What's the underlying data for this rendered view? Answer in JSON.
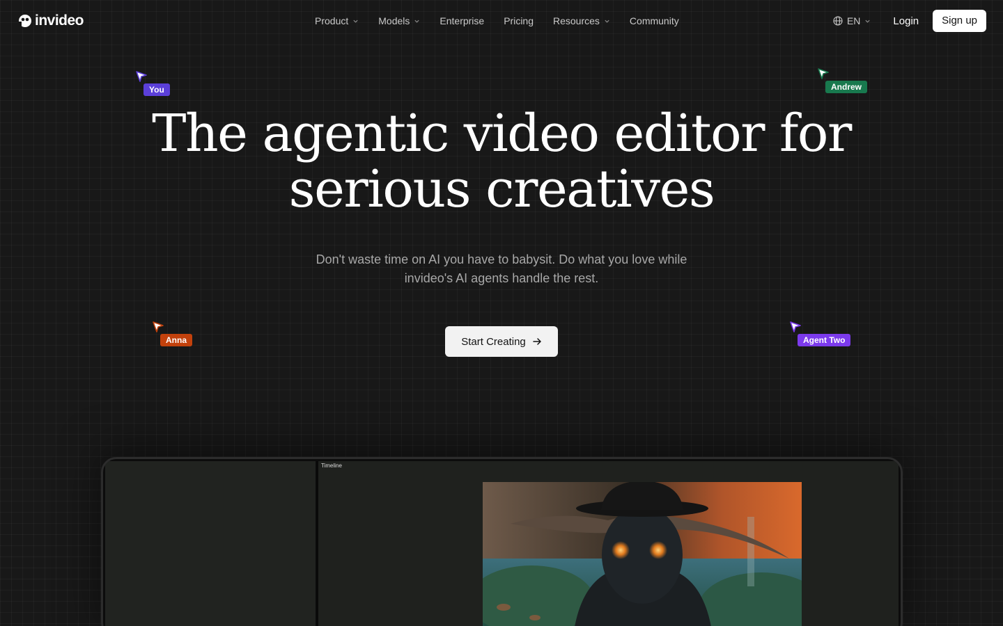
{
  "brand": {
    "name": "invideo"
  },
  "nav": {
    "items": [
      {
        "label": "Product",
        "has_dropdown": true
      },
      {
        "label": "Models",
        "has_dropdown": true
      },
      {
        "label": "Enterprise",
        "has_dropdown": false
      },
      {
        "label": "Pricing",
        "has_dropdown": false
      },
      {
        "label": "Resources",
        "has_dropdown": true
      },
      {
        "label": "Community",
        "has_dropdown": false
      }
    ],
    "language": "EN",
    "login": "Login",
    "signup": "Sign up"
  },
  "hero": {
    "title_line1": "The agentic video editor for",
    "title_line2": "serious creatives",
    "subtitle_line1": "Don't waste time on AI you have to babysit. Do what you love while",
    "subtitle_line2": "invideo's AI agents handle the rest.",
    "cta": "Start Creating"
  },
  "cursors": [
    {
      "label": "You",
      "color": "#5b3fd9"
    },
    {
      "label": "Andrew",
      "color": "#18794e"
    },
    {
      "label": "Anna",
      "color": "#c2410c"
    },
    {
      "label": "Agent Two",
      "color": "#7c3aed"
    }
  ],
  "editor": {
    "timeline_label": "Timeline"
  },
  "icons": {
    "logo": "invideo-logo-icon",
    "globe": "globe-icon",
    "chevron": "chevron-down-icon",
    "arrow": "arrow-right-icon",
    "cursor": "cursor-pointer-icon"
  }
}
